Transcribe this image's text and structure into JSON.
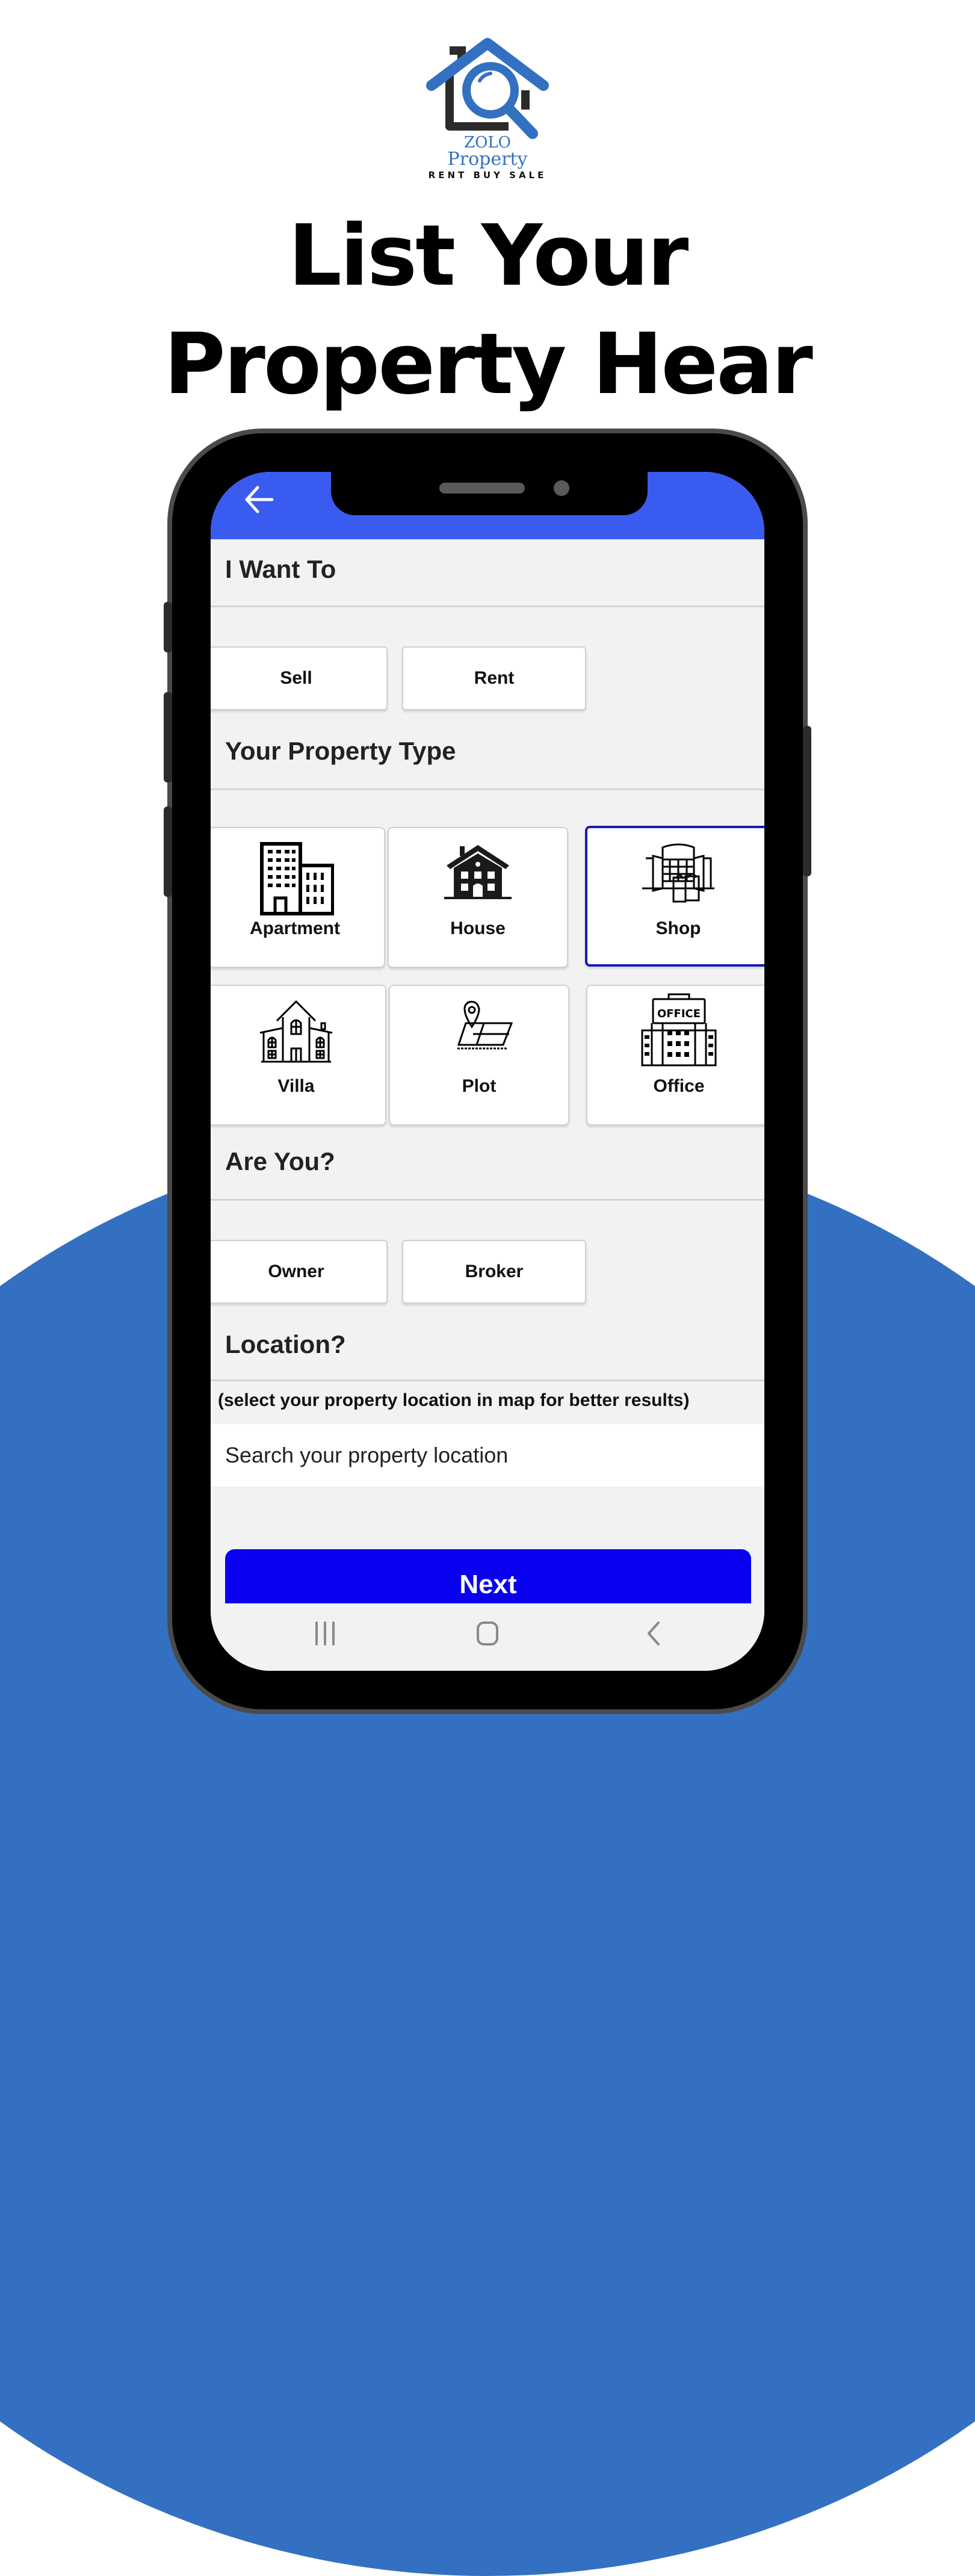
{
  "brand": {
    "name_line1": "ZOLO",
    "name_line2": "Property",
    "tagline": "RENT BUY SALE",
    "colors": {
      "primary": "#3470c2",
      "dark": "#2b2b2b"
    }
  },
  "headline": {
    "line1": "List Your",
    "line2": "Property Hear"
  },
  "app": {
    "appbar": {
      "back_icon": "arrow-left-icon",
      "color": "#3a5bf0"
    },
    "sections": {
      "intent": {
        "title": "I Want To",
        "options": [
          "Sell",
          "Rent"
        ]
      },
      "property_type": {
        "title": "Your Property Type",
        "selected": "Shop",
        "options": [
          {
            "label": "Apartment",
            "icon": "apartment-icon"
          },
          {
            "label": "House",
            "icon": "house-icon"
          },
          {
            "label": "Shop",
            "icon": "shop-icon"
          },
          {
            "label": "Villa",
            "icon": "villa-icon"
          },
          {
            "label": "Plot",
            "icon": "plot-icon"
          },
          {
            "label": "Office",
            "icon": "office-icon",
            "sign_text": "OFFICE"
          }
        ]
      },
      "role": {
        "title": "Are You?",
        "options": [
          "Owner",
          "Broker"
        ]
      },
      "location": {
        "title": "Location?",
        "hint": "(select your property location in map for better results)",
        "search_placeholder": "Search your property location",
        "search_value": ""
      }
    },
    "next_button": {
      "label": "Next",
      "color": "#0a00f0"
    },
    "system_nav": {
      "recents": "recents-icon",
      "home": "home-icon",
      "back": "back-icon"
    },
    "selected_border_color": "#1a1ab8"
  }
}
